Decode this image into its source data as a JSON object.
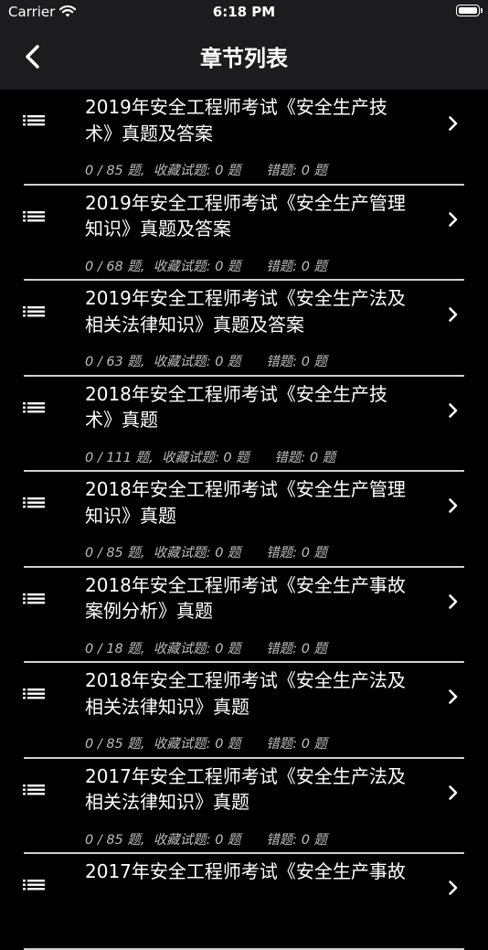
{
  "status_bar": {
    "carrier": "Carrier",
    "time": "6:18 PM"
  },
  "nav": {
    "title": "章节列表",
    "back_icon": "chevron-left-icon"
  },
  "chapters": [
    {
      "title": "2019年安全工程师考试《安全生产技术》真题及答案",
      "meta": "0 / 85 题,  收藏试题: 0 题      错题: 0 题"
    },
    {
      "title": "2019年安全工程师考试《安全生产管理知识》真题及答案",
      "meta": "0 / 68 题,  收藏试题: 0 题      错题: 0 题"
    },
    {
      "title": "2019年安全工程师考试《安全生产法及相关法律知识》真题及答案",
      "meta": "0 / 63 题,  收藏试题: 0 题      错题: 0 题"
    },
    {
      "title": "2018年安全工程师考试《安全生产技术》真题",
      "meta": "0 / 111 题,  收藏试题: 0 题      错题: 0 题"
    },
    {
      "title": "2018年安全工程师考试《安全生产管理知识》真题",
      "meta": "0 / 85 题,  收藏试题: 0 题      错题: 0 题"
    },
    {
      "title": "2018年安全工程师考试《安全生产事故案例分析》真题",
      "meta": "0 / 18 题,  收藏试题: 0 题      错题: 0 题"
    },
    {
      "title": "2018年安全工程师考试《安全生产法及相关法律知识》真题",
      "meta": "0 / 85 题,  收藏试题: 0 题      错题: 0 题"
    },
    {
      "title": "2017年安全工程师考试《安全生产法及相关法律知识》真题",
      "meta": "0 / 85 题,  收藏试题: 0 题      错题: 0 题"
    },
    {
      "title": "2017年安全工程师考试《安全生产事故",
      "meta": ""
    }
  ]
}
